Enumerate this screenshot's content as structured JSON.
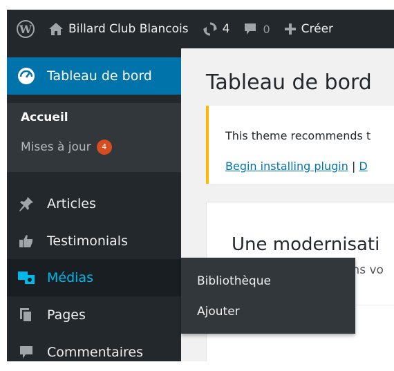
{
  "adminbar": {
    "site_name": "Billard Club Blancois",
    "updates_count": "4",
    "comments_count": "0",
    "new_label": "Créer",
    "icons": [
      "wordpress-icon",
      "home-icon",
      "updates-icon",
      "comment-icon",
      "plus-icon"
    ]
  },
  "sidebar": {
    "current": {
      "label": "Tableau de bord",
      "icon": "dashboard-icon"
    },
    "submenu": [
      {
        "label": "Accueil"
      },
      {
        "label": "Mises à jour",
        "badge": "4"
      }
    ],
    "items": [
      {
        "label": "Articles",
        "icon": "pushpin-icon"
      },
      {
        "label": "Testimonials",
        "icon": "thumbs-up-icon"
      },
      {
        "label": "Médias",
        "icon": "media-icon"
      },
      {
        "label": "Pages",
        "icon": "pages-icon"
      },
      {
        "label": "Commentaires",
        "icon": "comment-icon"
      }
    ]
  },
  "flyout": {
    "items": [
      "Bibliothèque",
      "Ajouter"
    ]
  },
  "content": {
    "title": "Tableau de bord",
    "notice": {
      "message": "This theme recommends t",
      "link1": "Begin installing plugin",
      "separator": " | ",
      "link2": "D"
    },
    "postbox": {
      "title": "Une modernisati",
      "subtitle": "ans vo"
    }
  },
  "colors": {
    "adminbar_bg": "#23282d",
    "sidebar_bg": "#23282d",
    "current_bg": "#0073aa",
    "hover_text": "#00b9eb",
    "badge": "#d54e21",
    "notice_border": "#ffb900",
    "link": "#0073aa"
  }
}
